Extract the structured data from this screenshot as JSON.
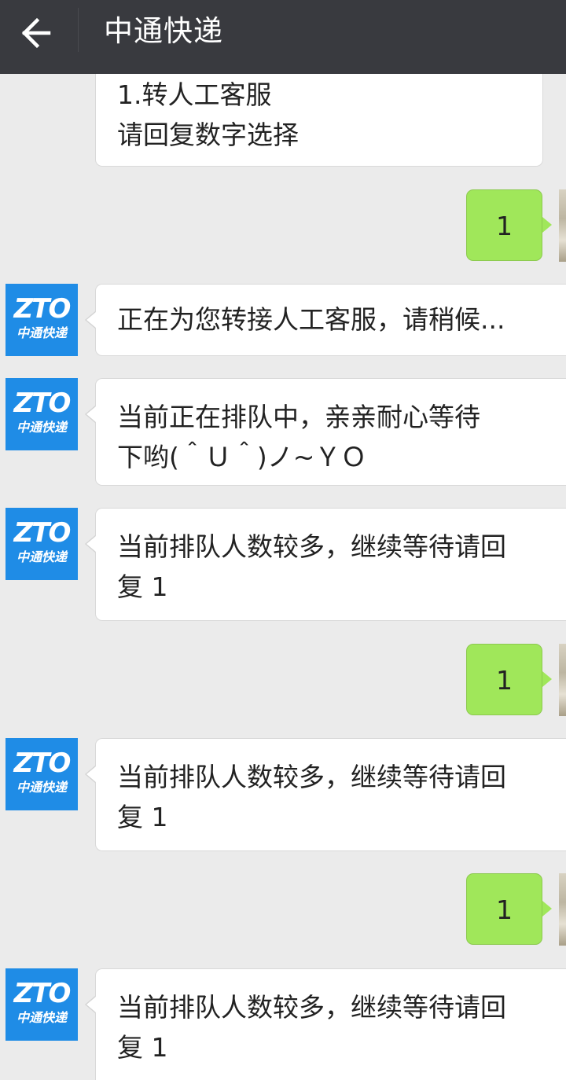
{
  "header": {
    "title": "中通快递",
    "back_icon": "arrow-left-icon",
    "background": "#393a3f"
  },
  "avatar": {
    "logo_text": "ZTO",
    "logo_sub": "中通快递",
    "color": "#1f8ce6"
  },
  "messages": [
    {
      "from": "bot",
      "lines": [
        "1.转人工客服",
        "请回复数字选择"
      ]
    },
    {
      "from": "me",
      "lines": [
        "1"
      ]
    },
    {
      "from": "bot",
      "lines": [
        "正在为您转接人工客服，请稍候..."
      ]
    },
    {
      "from": "bot",
      "lines": [
        "当前正在排队中，亲亲耐心等待",
        "下哟(＾Ｕ＾)ノ~ＹＯ"
      ]
    },
    {
      "from": "bot",
      "lines": [
        "当前排队人数较多，继续等待请回",
        "复 1"
      ]
    },
    {
      "from": "me",
      "lines": [
        "1"
      ]
    },
    {
      "from": "bot",
      "lines": [
        "当前排队人数较多，继续等待请回",
        "复 1"
      ]
    },
    {
      "from": "me",
      "lines": [
        "1"
      ]
    },
    {
      "from": "bot",
      "lines": [
        "当前排队人数较多，继续等待请回",
        "复 1"
      ]
    }
  ],
  "colors": {
    "bubble_in": "#ffffff",
    "bubble_out": "#a0e75a",
    "chat_background": "#ebebeb"
  }
}
